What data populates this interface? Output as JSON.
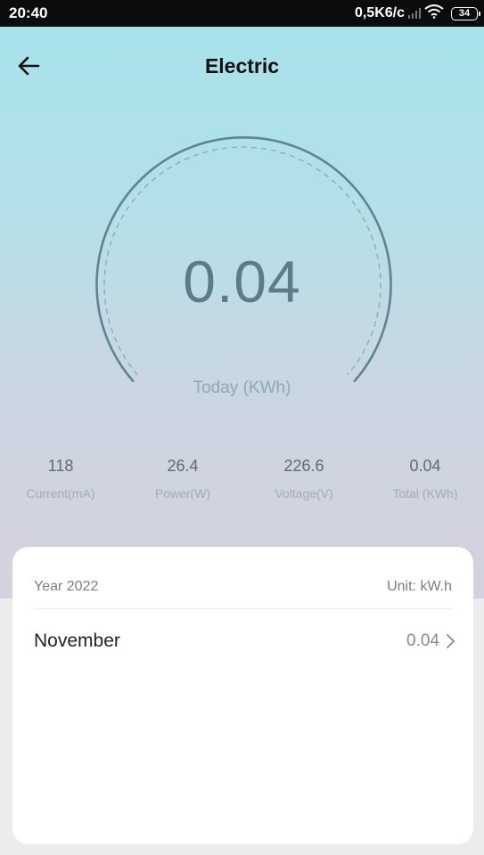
{
  "status_bar": {
    "time": "20:40",
    "network_speed": "0,5K6/c",
    "battery": "34"
  },
  "header": {
    "title": "Electric",
    "back_icon": "arrow-left-icon"
  },
  "gauge": {
    "value": "0.04",
    "label": "Today (KWh)",
    "color": "#5f8391"
  },
  "stats": [
    {
      "value": "118",
      "label": "Current(mA)"
    },
    {
      "value": "26.4",
      "label": "Power(W)"
    },
    {
      "value": "226.6",
      "label": "Voltage(V)"
    },
    {
      "value": "0.04",
      "label": "Total (KWh)"
    }
  ],
  "card": {
    "year": "Year 2022",
    "unit": "Unit: kW.h",
    "months": [
      {
        "name": "November",
        "value": "0.04",
        "icon": "chevron-right-icon"
      }
    ]
  },
  "colors": {
    "gradient_top": "#a6e2eb",
    "gradient_bottom": "#d4d2df",
    "text_dark": "#111111"
  }
}
